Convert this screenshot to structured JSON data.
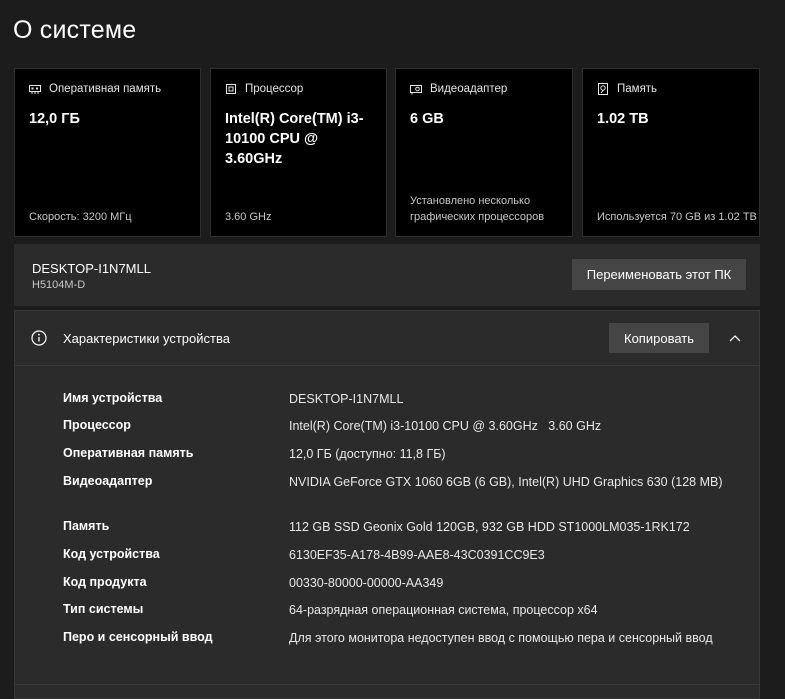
{
  "page": {
    "title": "О системе"
  },
  "cards": [
    {
      "icon": "memory-icon",
      "label": "Оперативная память",
      "value": "12,0 ГБ",
      "footer": "Скорость: 3200 МГц"
    },
    {
      "icon": "processor-icon",
      "label": "Процессор",
      "value": "Intel(R) Core(TM) i3-10100 CPU @ 3.60GHz",
      "footer": "3.60 GHz"
    },
    {
      "icon": "gpu-icon",
      "label": "Видеоадаптер",
      "value": "6 GB",
      "footer": "Установлено несколько графических процессоров"
    },
    {
      "icon": "storage-icon",
      "label": "Память",
      "value": "1.02 TB",
      "footer": "Используется 70 GB из 1.02 TB"
    }
  ],
  "pc": {
    "name": "DESKTOP-I1N7MLL",
    "model": "H5104M-D",
    "rename_label": "Переименовать этот ПК"
  },
  "specs": {
    "title": "Характеристики устройства",
    "copy_label": "Копировать",
    "rows": [
      {
        "label": "Имя устройства",
        "value": "DESKTOP-I1N7MLL"
      },
      {
        "label": "Процессор",
        "value": "Intel(R) Core(TM) i3-10100 CPU @ 3.60GHz   3.60 GHz"
      },
      {
        "label": "Оперативная память",
        "value": "12,0 ГБ (доступно: 11,8 ГБ)"
      },
      {
        "label": "Видеоадаптер",
        "value": "NVIDIA GeForce GTX 1060 6GB (6 GB), Intel(R) UHD Graphics 630 (128 MB)"
      },
      {
        "label": "Память",
        "value": "112 GB SSD Geonix Gold 120GB, 932 GB HDD ST1000LM035-1RK172"
      },
      {
        "label": "Код устройства",
        "value": "6130EF35-A178-4B99-AAE8-43C0391CC9E3"
      },
      {
        "label": "Код продукта",
        "value": "00330-80000-00000-AA349"
      },
      {
        "label": "Тип системы",
        "value": "64-разрядная операционная система, процессор x64"
      },
      {
        "label": "Перо и сенсорный ввод",
        "value": "Для этого монитора недоступен ввод с помощью пера и сенсорный ввод"
      }
    ]
  }
}
